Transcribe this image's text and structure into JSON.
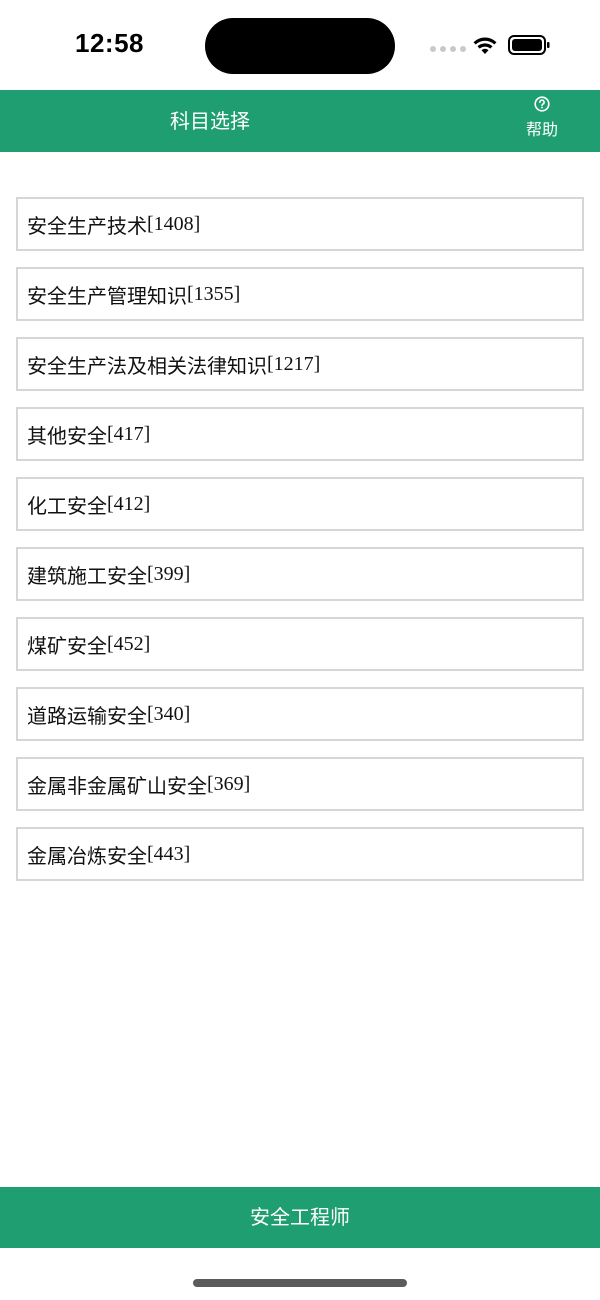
{
  "status_bar": {
    "time": "12:58",
    "icons": [
      "signal-dots-icon",
      "wifi-icon",
      "battery-icon"
    ]
  },
  "header": {
    "title": "科目选择",
    "help_label": "帮助",
    "help_icon": "question-circle-icon"
  },
  "subjects": [
    {
      "name": "安全生产技术",
      "count": "[1408]"
    },
    {
      "name": "安全生产管理知识",
      "count": "[1355]"
    },
    {
      "name": "安全生产法及相关法律知识",
      "count": "[1217]"
    },
    {
      "name": "其他安全",
      "count": "[417]"
    },
    {
      "name": "化工安全",
      "count": "[412]"
    },
    {
      "name": "建筑施工安全",
      "count": "[399]"
    },
    {
      "name": "煤矿安全",
      "count": "[452]"
    },
    {
      "name": "道路运输安全",
      "count": "[340]"
    },
    {
      "name": "金属非金属矿山安全",
      "count": "[369]"
    },
    {
      "name": "金属冶炼安全",
      "count": "[443]"
    }
  ],
  "bottom_bar": {
    "label": "安全工程师"
  },
  "colors": {
    "brand_green": "#1f9e72",
    "item_border": "#d6d6d6"
  }
}
